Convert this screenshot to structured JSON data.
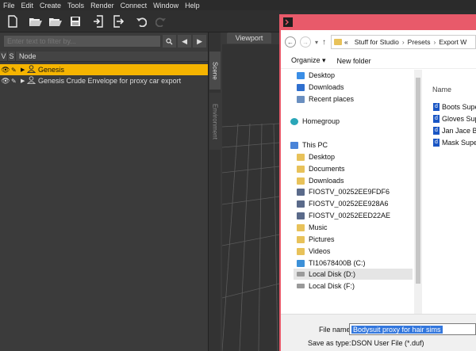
{
  "menu": [
    "File",
    "Edit",
    "Create",
    "Tools",
    "Render",
    "Connect",
    "Window",
    "Help"
  ],
  "toolbar": {
    "buttons": [
      "new-file-icon",
      "open-folder-icon",
      "open-folder-icon",
      "save-icon",
      "import-icon",
      "export-icon",
      "undo-icon",
      "redo-icon"
    ]
  },
  "scene": {
    "filter_placeholder": "Enter text to filter by...",
    "columns": {
      "v": "V",
      "s": "S",
      "node": "Node"
    },
    "nodes": [
      {
        "label": "Genesis",
        "selected": true
      },
      {
        "label": "Genesis Crude Envelope for proxy car export",
        "selected": false
      }
    ]
  },
  "side_tabs": {
    "scene": "Scene",
    "environment": "Environment"
  },
  "viewport": {
    "tab": "Viewport"
  },
  "dialog": {
    "title_visible": "Export W",
    "breadcrumb": [
      "«",
      "Stuff for Studio",
      "Presets",
      "Export W"
    ],
    "organize": "Organize ▾",
    "new_folder": "New folder",
    "nav_items": [
      {
        "label": "Desktop",
        "icon": "desktop"
      },
      {
        "label": "Downloads",
        "icon": "downloads"
      },
      {
        "label": "Recent places",
        "icon": "recent"
      },
      {
        "label": "Homegroup",
        "icon": "homegroup"
      },
      {
        "label": "This PC",
        "icon": "pc"
      },
      {
        "label": "Desktop",
        "icon": "folder"
      },
      {
        "label": "Documents",
        "icon": "folder"
      },
      {
        "label": "Downloads",
        "icon": "folder"
      },
      {
        "label": "FIOSTV_00252EE9FDF6",
        "icon": "media"
      },
      {
        "label": "FIOSTV_00252EE928A6",
        "icon": "media"
      },
      {
        "label": "FIOSTV_00252EED22AE",
        "icon": "media"
      },
      {
        "label": "Music",
        "icon": "folder"
      },
      {
        "label": "Pictures",
        "icon": "folder"
      },
      {
        "label": "Videos",
        "icon": "folder"
      },
      {
        "label": "TI10678400B (C:)",
        "icon": "drive"
      },
      {
        "label": "Local Disk (D:)",
        "icon": "drive"
      },
      {
        "label": "Local Disk (F:)",
        "icon": "drive"
      }
    ],
    "file_header": "Name",
    "files": [
      "Boots Supe",
      "Gloves Sup",
      "Jan Jace Bo",
      "Mask Super"
    ],
    "file_name_label": "File name:",
    "file_name_value": "Bodysuit proxy for hair sims",
    "save_type_label": "Save as type:",
    "save_type_value": "DSON User File (*.duf)"
  },
  "colors": {
    "accent": "#f5b400",
    "dialog_frame": "#e85a6a"
  }
}
